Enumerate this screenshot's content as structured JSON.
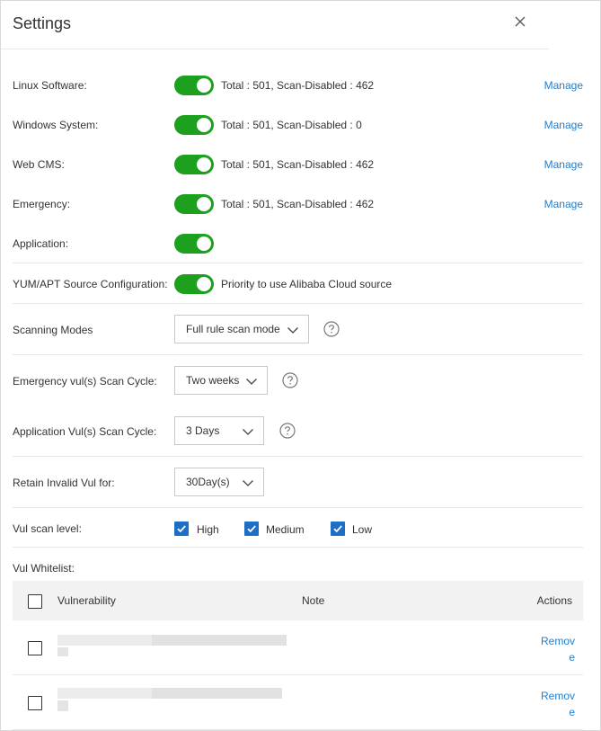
{
  "dialog": {
    "title": "Settings"
  },
  "toggles": [
    {
      "label": "Linux Software:",
      "on": true,
      "status": "Total : 501, Scan-Disabled : 462",
      "action": "Manage"
    },
    {
      "label": "Windows System:",
      "on": true,
      "status": "Total : 501, Scan-Disabled : 0",
      "action": "Manage"
    },
    {
      "label": "Web CMS:",
      "on": true,
      "status": "Total : 501, Scan-Disabled : 462",
      "action": "Manage"
    },
    {
      "label": "Emergency:",
      "on": true,
      "status": "Total : 501, Scan-Disabled : 462",
      "action": "Manage"
    },
    {
      "label": "Application:",
      "on": true
    }
  ],
  "source_config": {
    "label": "YUM/APT Source Configuration:",
    "on": true,
    "text": "Priority to use Alibaba Cloud source"
  },
  "scanning_modes": {
    "label": "Scanning Modes",
    "value": "Full rule scan mode"
  },
  "emergency_cycle": {
    "label": "Emergency vul(s) Scan Cycle:",
    "value": "Two weeks"
  },
  "application_cycle": {
    "label": "Application Vul(s) Scan Cycle:",
    "value": "3 Days"
  },
  "retain": {
    "label": "Retain Invalid Vul for:",
    "value": "30Day(s)"
  },
  "scan_level": {
    "label": "Vul scan level:",
    "options": [
      {
        "label": "High",
        "checked": true
      },
      {
        "label": "Medium",
        "checked": true
      },
      {
        "label": "Low",
        "checked": true
      }
    ]
  },
  "whitelist": {
    "label": "Vul Whitelist:",
    "columns": [
      "Vulnerability",
      "Note",
      "Actions"
    ],
    "rows": [
      {
        "action": "Remove"
      },
      {
        "action": "Remove"
      }
    ]
  },
  "colors": {
    "toggle_on": "#1da01d",
    "link": "#1e7fd0",
    "checkbox": "#1c6fc4"
  }
}
